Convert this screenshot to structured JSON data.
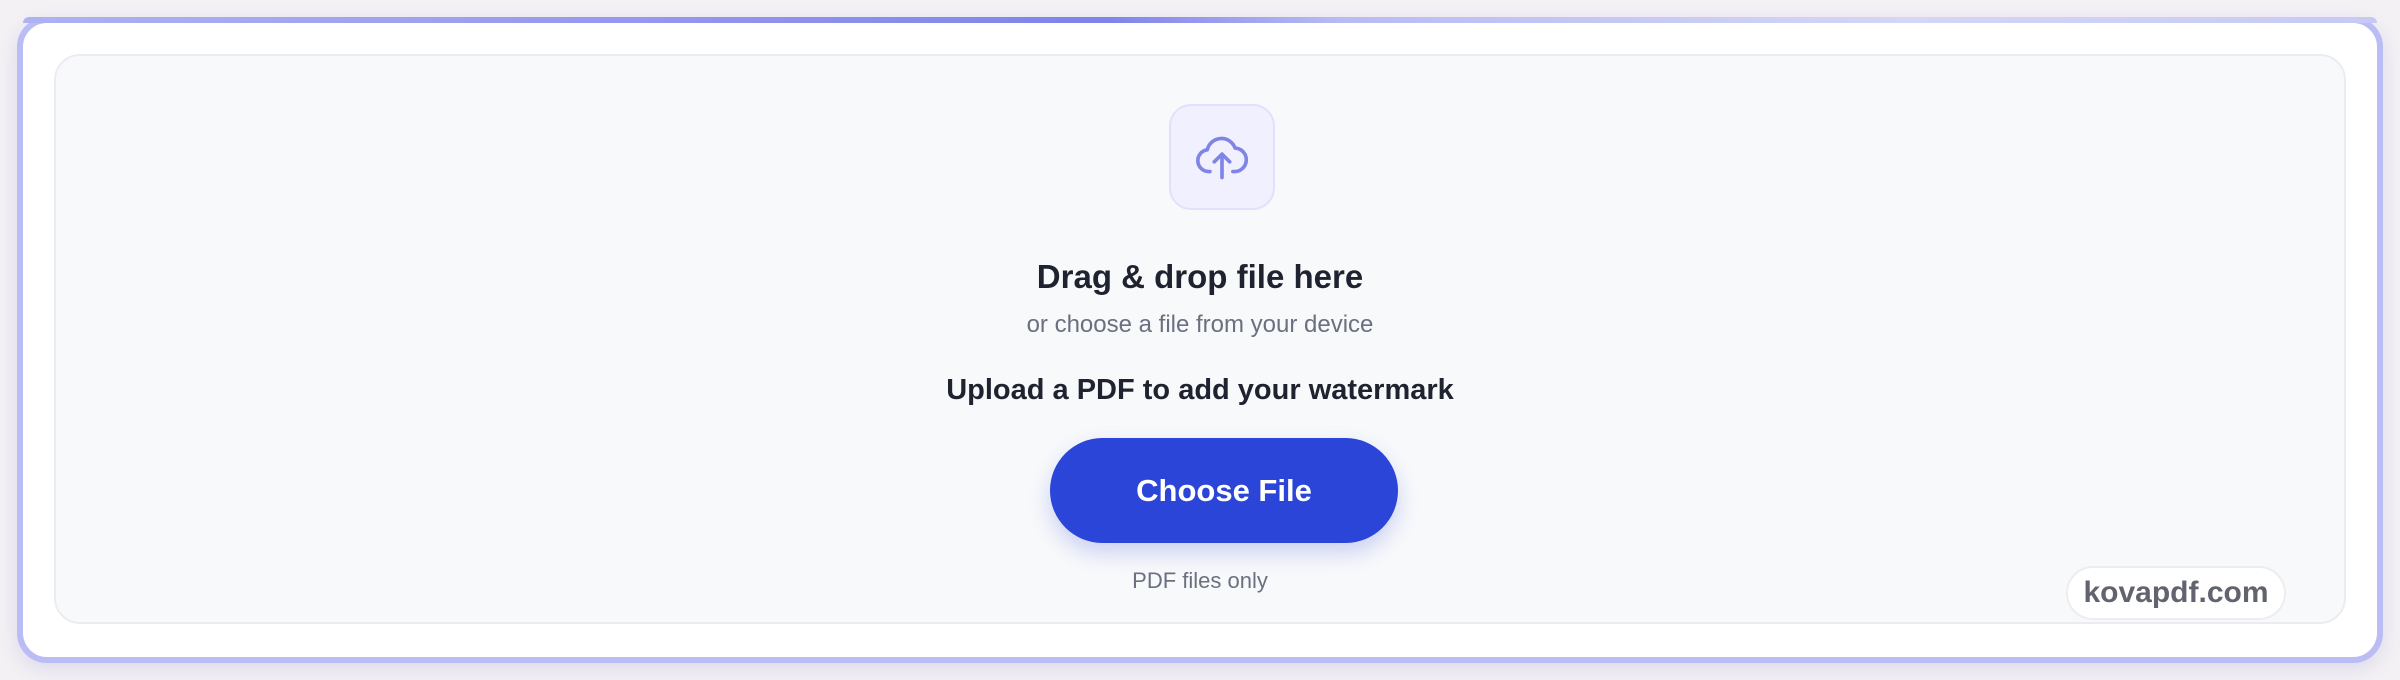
{
  "dropzone": {
    "icon": "cloud-upload-icon",
    "title": "Drag & drop file here",
    "subtitle": "or choose a file from your device",
    "instruction": "Upload a PDF to add your watermark",
    "choose_button_label": "Choose File",
    "hint": "PDF files only"
  },
  "brand": {
    "label": "kovapdf.com"
  },
  "colors": {
    "accent": "#2b45d8",
    "frame": "#b9bdf3",
    "icon": "#7f84e6"
  }
}
